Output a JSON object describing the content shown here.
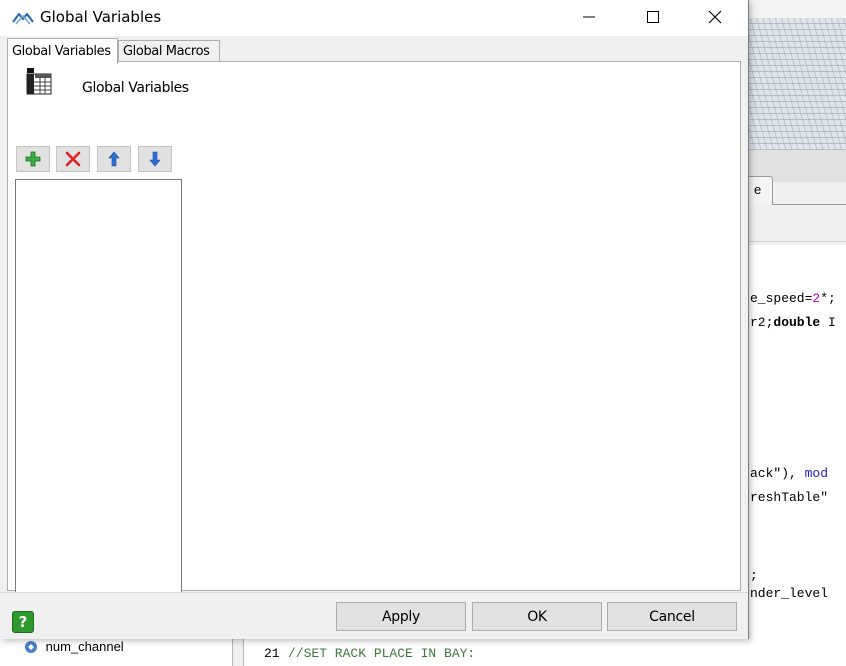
{
  "dialog": {
    "title": "Global Variables",
    "tabs": [
      {
        "label": "Global Variables",
        "active": true
      },
      {
        "label": "Global Macros",
        "active": false
      }
    ],
    "header_label": "Global Variables",
    "toolbar": {
      "add": "add-icon",
      "delete": "delete-icon",
      "move_up": "arrow-up-icon",
      "move_down": "arrow-down-icon"
    },
    "list_items": [],
    "buttons": {
      "help": "?",
      "apply": "Apply",
      "ok": "OK",
      "cancel": "Cancel"
    }
  },
  "background": {
    "tab_fragment": "e",
    "code_lines": [
      {
        "parts": [
          {
            "text": "e_speed=",
            "color": "#000000"
          },
          {
            "text": "2",
            "color": "#c000c0"
          },
          {
            "text": "*;",
            "color": "#000000"
          }
        ]
      },
      {
        "parts": [
          {
            "text": "r2;",
            "color": "#000000"
          },
          {
            "text": "double ",
            "color": "#000000",
            "bold": true
          },
          {
            "text": "I",
            "color": "#000000"
          }
        ]
      },
      {
        "parts": [
          {
            "text": "ack\"), ",
            "color": "#000000"
          },
          {
            "text": "mod",
            "color": "#2020c0"
          }
        ]
      },
      {
        "parts": [
          {
            "text": "reshTable\"",
            "color": "#000000"
          }
        ]
      },
      {
        "parts": [
          {
            "text": ";",
            "color": "#000000"
          }
        ]
      },
      {
        "parts": [
          {
            "text": "nder_level",
            "color": "#000000"
          }
        ]
      }
    ],
    "tree_item": "num_channel",
    "line_number": "21",
    "comment": "//SET RACK PLACE IN BAY:",
    "colors": {
      "comment": "#3c7a3c",
      "number": "#c000c0",
      "keyword": "#2020c0"
    }
  }
}
